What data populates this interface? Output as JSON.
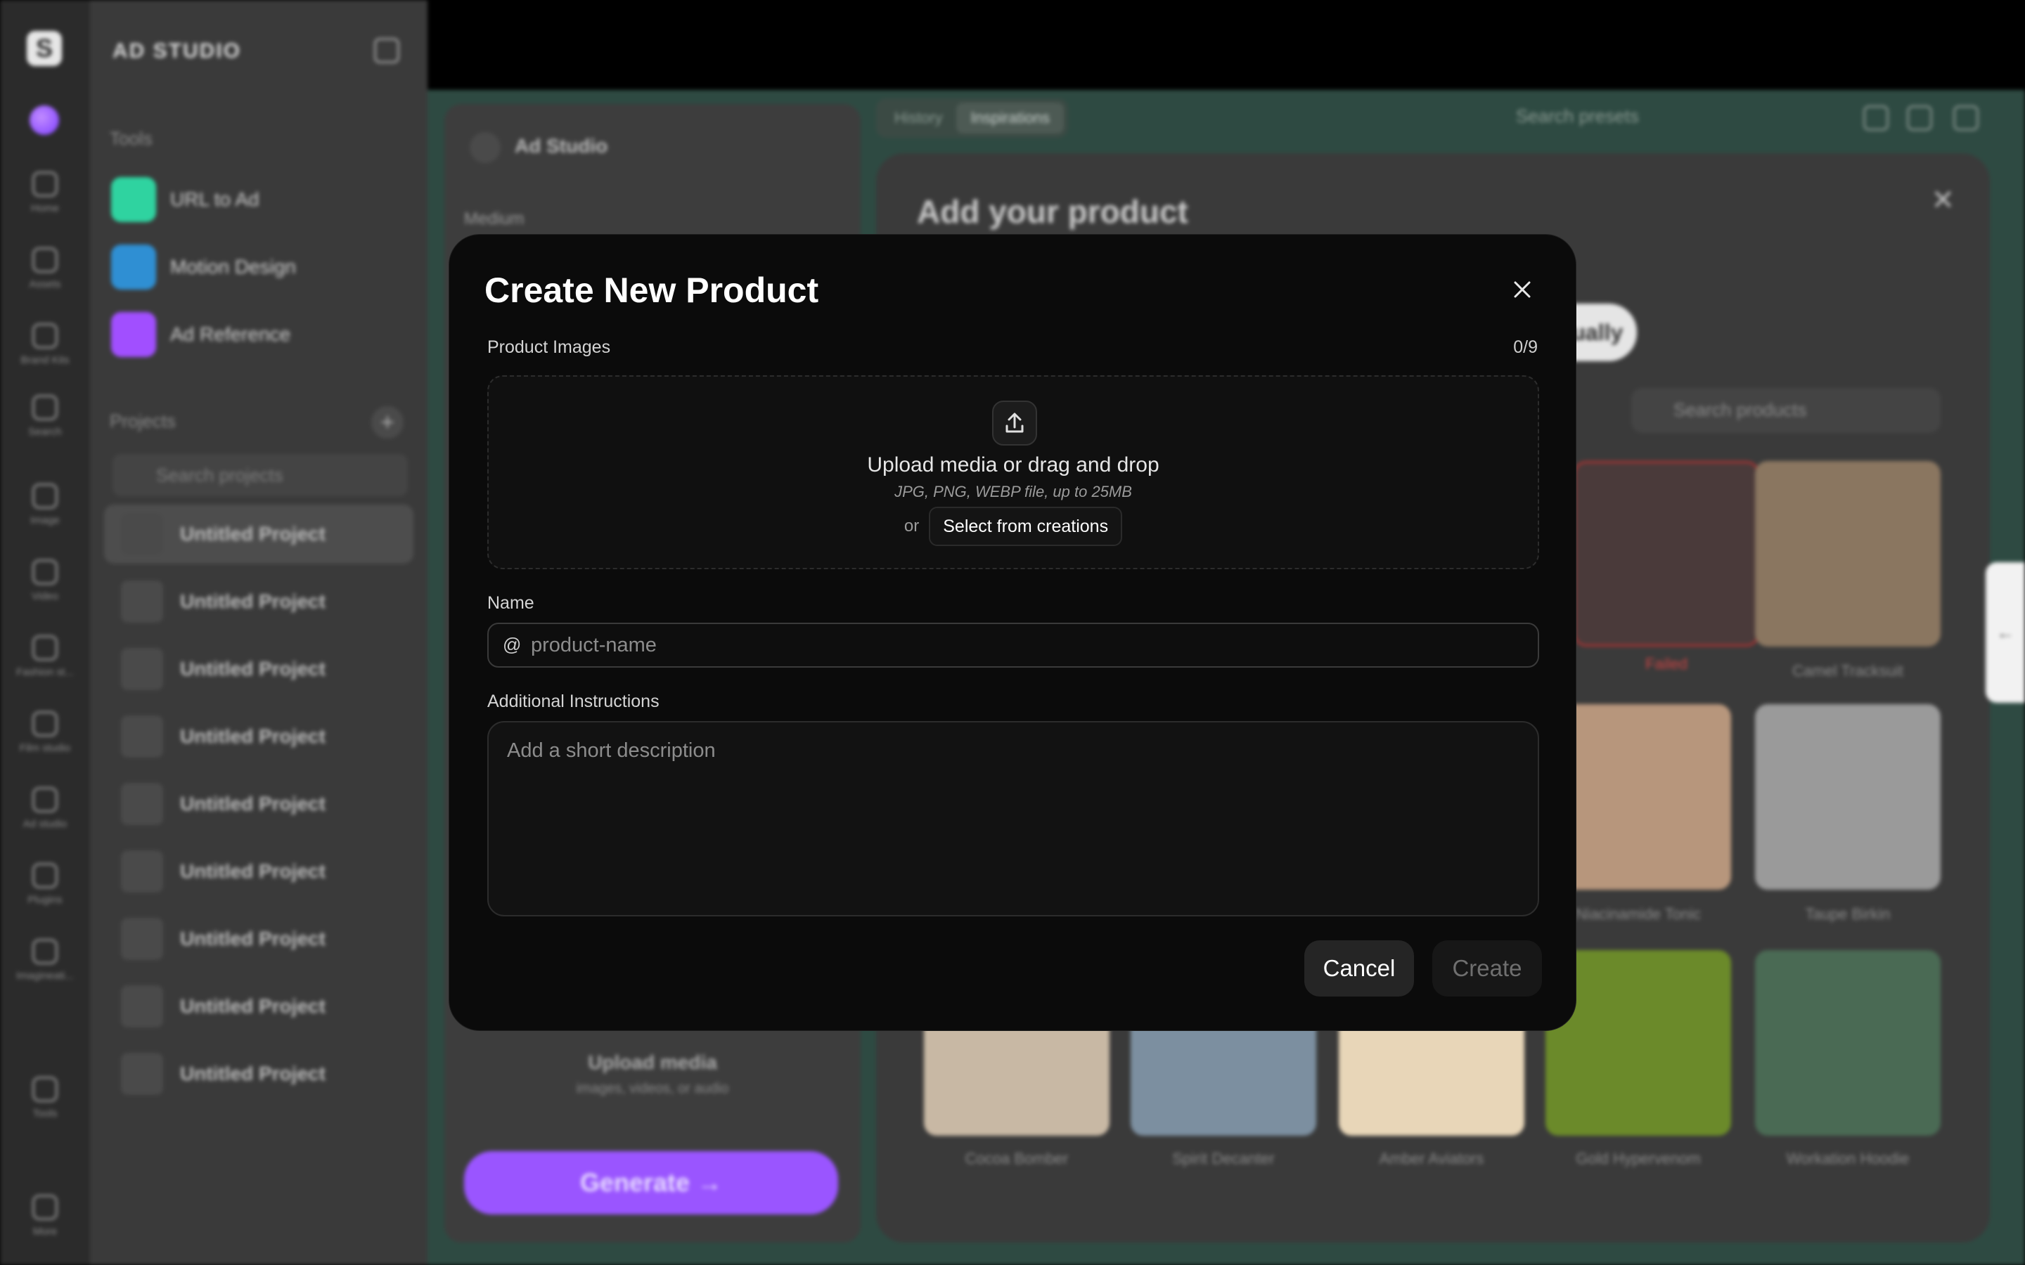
{
  "background": {
    "rail": [
      {
        "label": "Home"
      },
      {
        "label": "Assets"
      },
      {
        "label": "Brand Kits"
      },
      {
        "label": "Search"
      },
      {
        "label": "Image"
      },
      {
        "label": "Video"
      },
      {
        "label": "Fashion st..."
      },
      {
        "label": "Film studio"
      },
      {
        "label": "Ad studio"
      },
      {
        "label": "Plugins"
      },
      {
        "label": "Imagineati..."
      },
      {
        "label": "Tools"
      },
      {
        "label": "More"
      }
    ],
    "sidebar": {
      "brand": "AD STUDIO",
      "tools_heading": "Tools",
      "tools": [
        {
          "label": "URL to Ad",
          "color": "#2fd3a0"
        },
        {
          "label": "Motion Design",
          "color": "#2f8fd3"
        },
        {
          "label": "Ad Reference",
          "color": "#a14fff"
        }
      ],
      "projects_heading": "Projects",
      "project_search_placeholder": "Search projects",
      "projects": [
        "Untitled Project",
        "Untitled Project",
        "Untitled Project",
        "Untitled Project",
        "Untitled Project",
        "Untitled Project",
        "Untitled Project",
        "Untitled Project",
        "Untitled Project"
      ]
    },
    "left_panel": {
      "title": "Ad Studio",
      "medium_label": "Medium",
      "upload_title": "Upload media",
      "upload_sub": "images, videos, or audio",
      "generate_label": "Generate  →"
    },
    "tabs": [
      "History",
      "Inspirations"
    ],
    "preset_search": "Search presets",
    "right_panel": {
      "heading": "Add your product",
      "manual_label": "anually",
      "product_search_placeholder": "Search products",
      "tiles": [
        {
          "caption": "Failed",
          "color": "#4a3a3a"
        },
        {
          "caption": "Camel Tracksuit",
          "color": "#8a7660"
        },
        {
          "caption": "Niacinamide Tonic",
          "color": "#b7967c"
        },
        {
          "caption": "Taupe Birkin",
          "color": "#9a9a9a"
        },
        {
          "caption": "Cocoa Bomber",
          "color": "#c8b8a4"
        },
        {
          "caption": "Spirit Decanter",
          "color": "#7c8fa0"
        },
        {
          "caption": "Amber Aviators",
          "color": "#e8d6b8"
        },
        {
          "caption": "Gold Hypervenom",
          "color": "#6b8a2a"
        },
        {
          "caption": "Workation Hoodie",
          "color": "#4a6a54"
        }
      ]
    }
  },
  "modal": {
    "title": "Create New Product",
    "images_label": "Product Images",
    "images_count": "0/9",
    "upload_title": "Upload media or drag and drop",
    "upload_hint": "JPG, PNG, WEBP file, up to 25MB",
    "or_text": "or",
    "select_creations": "Select from creations",
    "name_label": "Name",
    "name_prefix": "@",
    "name_placeholder": "product-name",
    "instructions_label": "Additional Instructions",
    "instructions_placeholder": "Add a short description",
    "cancel_label": "Cancel",
    "create_label": "Create"
  }
}
